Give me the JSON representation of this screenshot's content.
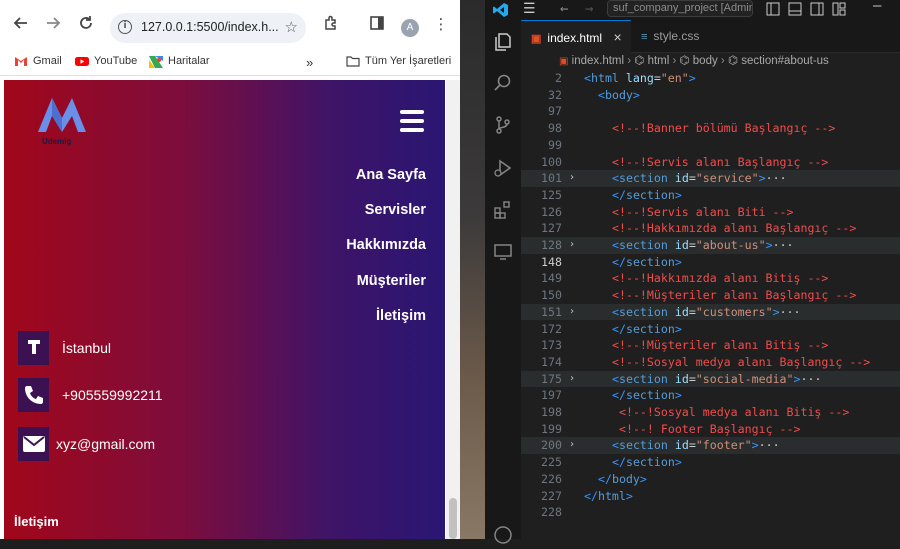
{
  "browser": {
    "url": "127.0.0.1:5500/index.h...",
    "avatar_letter": "A",
    "bookmarks": [
      {
        "label": "Gmail"
      },
      {
        "label": "YouTube"
      },
      {
        "label": "Haritalar"
      }
    ],
    "bookmarks_more": "»",
    "all_bookmarks": "Tüm Yer İşaretleri"
  },
  "site": {
    "logo_text": "Udemig",
    "nav": [
      "Ana Sayfa",
      "Servisler",
      "Hakkımızda",
      "Müşteriler",
      "İletişim"
    ],
    "contacts": [
      {
        "icon": "pin-icon",
        "text": "İstanbul"
      },
      {
        "icon": "phone-icon",
        "text": "+905559992211"
      },
      {
        "icon": "mail-icon",
        "text": "xyz@gmail.com"
      }
    ],
    "footer_heading": "İletişim"
  },
  "vscode": {
    "title": "suf_company_project [Adminis",
    "tabs": [
      {
        "label": "index.html",
        "close": "×"
      },
      {
        "label": "style.css"
      }
    ],
    "breadcrumb": [
      "index.html",
      "html",
      "body",
      "section#about-us"
    ],
    "lines": [
      {
        "n": "2",
        "indent": 0,
        "fold": false,
        "parts": [
          [
            "tag",
            "<"
          ],
          [
            "tagname",
            "html"
          ],
          [
            "text",
            " "
          ],
          [
            "attr",
            "lang"
          ],
          [
            "text",
            "="
          ],
          [
            "str",
            "\"en\""
          ],
          [
            "tag",
            ">"
          ]
        ]
      },
      {
        "n": "32",
        "indent": 1,
        "fold": false,
        "parts": [
          [
            "tag",
            "<"
          ],
          [
            "tagname",
            "body"
          ],
          [
            "tag",
            ">"
          ]
        ]
      },
      {
        "n": "97",
        "indent": 0,
        "fold": false,
        "parts": []
      },
      {
        "n": "98",
        "indent": 2,
        "fold": false,
        "parts": [
          [
            "cmt",
            "<!--!Banner bölümü Başlangıç -->"
          ]
        ]
      },
      {
        "n": "99",
        "indent": 0,
        "fold": false,
        "parts": []
      },
      {
        "n": "100",
        "indent": 2,
        "fold": false,
        "parts": [
          [
            "cmt",
            "<!--!Servis alanı Başlangıç -->"
          ]
        ]
      },
      {
        "n": "101",
        "indent": 2,
        "fold": true,
        "hl": true,
        "parts": [
          [
            "tag",
            "<"
          ],
          [
            "tagname",
            "section"
          ],
          [
            "text",
            " "
          ],
          [
            "attr",
            "id"
          ],
          [
            "text",
            "="
          ],
          [
            "str",
            "\"service\""
          ],
          [
            "tag",
            ">"
          ],
          [
            "ell",
            "···"
          ]
        ]
      },
      {
        "n": "125",
        "indent": 2,
        "fold": false,
        "parts": [
          [
            "tag",
            "</"
          ],
          [
            "tagname",
            "section"
          ],
          [
            "tag",
            ">"
          ]
        ]
      },
      {
        "n": "126",
        "indent": 2,
        "fold": false,
        "parts": [
          [
            "cmt",
            "<!--!Servis alanı Biti -->"
          ]
        ]
      },
      {
        "n": "127",
        "indent": 2,
        "fold": false,
        "parts": [
          [
            "cmt",
            "<!--!Hakkımızda alanı Başlangıç -->"
          ]
        ]
      },
      {
        "n": "128",
        "indent": 2,
        "fold": true,
        "hl": true,
        "parts": [
          [
            "tag",
            "<"
          ],
          [
            "tagname",
            "section"
          ],
          [
            "text",
            " "
          ],
          [
            "attr",
            "id"
          ],
          [
            "text",
            "="
          ],
          [
            "str",
            "\"about-us\""
          ],
          [
            "tag",
            ">"
          ],
          [
            "ell",
            "···"
          ]
        ]
      },
      {
        "n": "148",
        "indent": 2,
        "fold": false,
        "cur": true,
        "parts": [
          [
            "tag",
            "</"
          ],
          [
            "tagname",
            "section"
          ],
          [
            "tag",
            ">"
          ]
        ]
      },
      {
        "n": "149",
        "indent": 2,
        "fold": false,
        "parts": [
          [
            "cmt",
            "<!--!Hakkımızda alanı Bitiş -->"
          ]
        ]
      },
      {
        "n": "150",
        "indent": 2,
        "fold": false,
        "parts": [
          [
            "cmt",
            "<!--!Müşteriler alanı Başlangıç -->"
          ]
        ]
      },
      {
        "n": "151",
        "indent": 2,
        "fold": true,
        "hl": true,
        "parts": [
          [
            "tag",
            "<"
          ],
          [
            "tagname",
            "section"
          ],
          [
            "text",
            " "
          ],
          [
            "attr",
            "id"
          ],
          [
            "text",
            "="
          ],
          [
            "str",
            "\"customers\""
          ],
          [
            "tag",
            ">"
          ],
          [
            "ell",
            "···"
          ]
        ]
      },
      {
        "n": "172",
        "indent": 2,
        "fold": false,
        "parts": [
          [
            "tag",
            "</"
          ],
          [
            "tagname",
            "section"
          ],
          [
            "tag",
            ">"
          ]
        ]
      },
      {
        "n": "173",
        "indent": 2,
        "fold": false,
        "parts": [
          [
            "cmt",
            "<!--!Müşteriler alanı Bitiş -->"
          ]
        ]
      },
      {
        "n": "174",
        "indent": 2,
        "fold": false,
        "parts": [
          [
            "cmt",
            "<!--!Sosyal medya alanı Başlangıç -->"
          ]
        ]
      },
      {
        "n": "175",
        "indent": 2,
        "fold": true,
        "hl": true,
        "parts": [
          [
            "tag",
            "<"
          ],
          [
            "tagname",
            "section"
          ],
          [
            "text",
            " "
          ],
          [
            "attr",
            "id"
          ],
          [
            "text",
            "="
          ],
          [
            "str",
            "\"social-media\""
          ],
          [
            "tag",
            ">"
          ],
          [
            "ell",
            "···"
          ]
        ]
      },
      {
        "n": "197",
        "indent": 2,
        "fold": false,
        "parts": [
          [
            "tag",
            "</"
          ],
          [
            "tagname",
            "section"
          ],
          [
            "tag",
            ">"
          ]
        ]
      },
      {
        "n": "198",
        "indent": 2,
        "fold": false,
        "parts": [
          [
            "text",
            " "
          ],
          [
            "cmt",
            "<!--!Sosyal medya alanı Bitiş -->"
          ]
        ]
      },
      {
        "n": "199",
        "indent": 2,
        "fold": false,
        "parts": [
          [
            "text",
            " "
          ],
          [
            "cmt",
            "<!--! Footer Başlangıç -->"
          ]
        ]
      },
      {
        "n": "200",
        "indent": 2,
        "fold": true,
        "hl": true,
        "parts": [
          [
            "tag",
            "<"
          ],
          [
            "tagname",
            "section"
          ],
          [
            "text",
            " "
          ],
          [
            "attr",
            "id"
          ],
          [
            "text",
            "="
          ],
          [
            "str",
            "\"footer\""
          ],
          [
            "tag",
            ">"
          ],
          [
            "ell",
            "···"
          ]
        ]
      },
      {
        "n": "225",
        "indent": 2,
        "fold": false,
        "parts": [
          [
            "tag",
            "</"
          ],
          [
            "tagname",
            "section"
          ],
          [
            "tag",
            ">"
          ]
        ]
      },
      {
        "n": "226",
        "indent": 1,
        "fold": false,
        "parts": [
          [
            "tag",
            "</"
          ],
          [
            "tagname",
            "body"
          ],
          [
            "tag",
            ">"
          ]
        ]
      },
      {
        "n": "227",
        "indent": 0,
        "fold": false,
        "parts": [
          [
            "tag",
            "</"
          ],
          [
            "tagname",
            "html"
          ],
          [
            "tag",
            ">"
          ]
        ]
      },
      {
        "n": "228",
        "indent": 0,
        "fold": false,
        "parts": []
      }
    ]
  }
}
